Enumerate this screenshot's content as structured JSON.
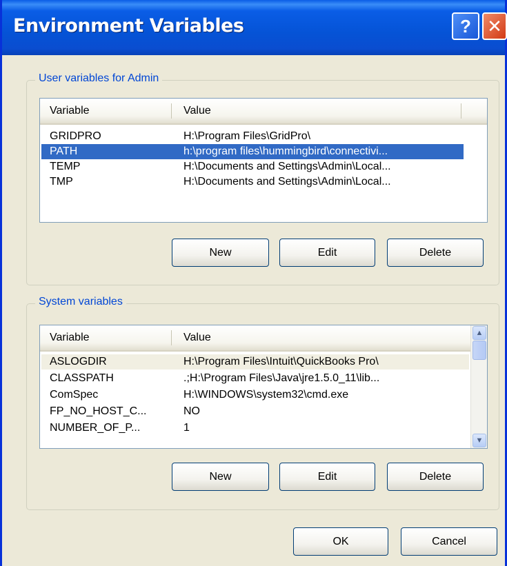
{
  "window": {
    "title": "Environment Variables",
    "help_label": "?",
    "close_label": "✕"
  },
  "user_group": {
    "label": "User variables for Admin",
    "columns": [
      "Variable",
      "Value"
    ],
    "rows": [
      {
        "variable": "GRIDPRO",
        "value": "H:\\Program Files\\GridPro\\"
      },
      {
        "variable": "PATH",
        "value": "h:\\program files\\hummingbird\\connectivi...",
        "selected": true
      },
      {
        "variable": "TEMP",
        "value": "H:\\Documents and Settings\\Admin\\Local..."
      },
      {
        "variable": "TMP",
        "value": "H:\\Documents and Settings\\Admin\\Local..."
      }
    ],
    "buttons": {
      "new": "New",
      "edit": "Edit",
      "delete": "Delete"
    }
  },
  "system_group": {
    "label": "System variables",
    "columns": [
      "Variable",
      "Value"
    ],
    "rows": [
      {
        "variable": "ASLOGDIR",
        "value": "H:\\Program Files\\Intuit\\QuickBooks Pro\\"
      },
      {
        "variable": "CLASSPATH",
        "value": ".;H:\\Program Files\\Java\\jre1.5.0_11\\lib..."
      },
      {
        "variable": "ComSpec",
        "value": "H:\\WINDOWS\\system32\\cmd.exe"
      },
      {
        "variable": "FP_NO_HOST_C...",
        "value": "NO"
      },
      {
        "variable": "NUMBER_OF_P...",
        "value": "1"
      }
    ],
    "buttons": {
      "new": "New",
      "edit": "Edit",
      "delete": "Delete"
    }
  },
  "footer": {
    "ok": "OK",
    "cancel": "Cancel"
  },
  "colors": {
    "titlebar": "#0a5de6",
    "selection": "#316ac5",
    "group_label": "#0046d5",
    "dialog_bg": "#ece9d8"
  }
}
